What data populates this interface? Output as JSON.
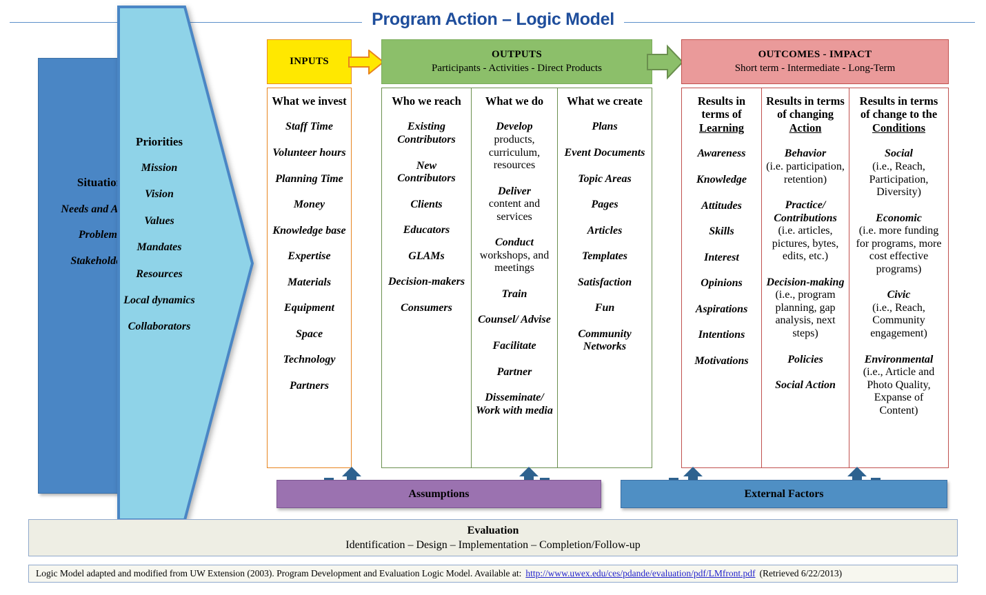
{
  "title": "Program Action – Logic Model",
  "situation": {
    "heading": "Situation",
    "items": [
      "Needs and Assets",
      "Problems",
      "Stakeholders"
    ]
  },
  "priorities": {
    "heading": "Priorities",
    "items": [
      "Mission",
      "Vision",
      "Values",
      "Mandates",
      "Resources",
      "Local dynamics",
      "Collaborators"
    ]
  },
  "banners": {
    "inputs": {
      "title": "INPUTS",
      "subtitle": ""
    },
    "outputs": {
      "title": "OUTPUTS",
      "subtitle": "Participants  -  Activities  -  Direct Products"
    },
    "outcomes": {
      "title": "OUTCOMES - IMPACT",
      "subtitle": "Short term  -  Intermediate  -  Long-Term"
    }
  },
  "columns": {
    "invest": {
      "heading": "What we invest",
      "items": [
        "Staff Time",
        "Volunteer hours",
        "Planning Time",
        "Money",
        "Knowledge base",
        "Expertise",
        "Materials",
        "Equipment",
        "Space",
        "Technology",
        "Partners"
      ]
    },
    "reach": {
      "heading": "Who we reach",
      "items": [
        "Existing Contributors",
        "New Contributors",
        "Clients",
        "Educators",
        "GLAMs",
        "Decision-makers",
        "Consumers"
      ]
    },
    "do": {
      "heading": "What we do",
      "items": [
        {
          "bold": "Develop",
          "plain": "products, curriculum, resources"
        },
        {
          "bold": "Deliver",
          "plain": "content and services"
        },
        {
          "bold": "Conduct",
          "plain": "workshops, and meetings"
        },
        {
          "bold": "Train",
          "plain": ""
        },
        {
          "bold": "Counsel/ Advise",
          "plain": ""
        },
        {
          "bold": "Facilitate",
          "plain": ""
        },
        {
          "bold": "Partner",
          "plain": ""
        },
        {
          "bold": "Disseminate/ Work with media",
          "plain": ""
        }
      ]
    },
    "create": {
      "heading": "What we create",
      "items": [
        "Plans",
        "Event Documents",
        "Topic Areas",
        "Pages",
        "Articles",
        "Templates",
        "Satisfaction",
        "Fun",
        "Community Networks"
      ]
    },
    "learning": {
      "heading_line1": "Results in terms of",
      "heading_underlined": "Learning",
      "items": [
        "Awareness",
        "Knowledge",
        "Attitudes",
        "Skills",
        "Interest",
        "Opinions",
        "Aspirations",
        "Intentions",
        "Motivations"
      ]
    },
    "action": {
      "heading_line1": "Results in terms of changing",
      "heading_underlined": "Action",
      "items": [
        {
          "bold": "Behavior",
          "plain": "(i.e. participation, retention)"
        },
        {
          "bold": "Practice/ Contributions",
          "plain": "(i.e. articles, pictures, bytes, edits, etc.)"
        },
        {
          "bold": "Decision-making",
          "plain": "(i.e., program planning, gap analysis, next steps)"
        },
        {
          "bold": "Policies",
          "plain": ""
        },
        {
          "bold": "Social Action",
          "plain": ""
        }
      ]
    },
    "conditions": {
      "heading_line1": "Results in terms of change to the",
      "heading_underlined": "Conditions",
      "items": [
        {
          "bold": "Social",
          "plain": "(i.e.,  Reach, Participation, Diversity)"
        },
        {
          "bold": "Economic",
          "plain": "(i.e. more funding for programs, more cost effective programs)"
        },
        {
          "bold": "Civic",
          "plain": "(i.e., Reach, Community engagement)"
        },
        {
          "bold": "Environmental",
          "plain": "(i.e., Article and Photo Quality, Expanse of Content)"
        }
      ]
    }
  },
  "bars": {
    "assumptions": "Assumptions",
    "external_factors": "External Factors"
  },
  "evaluation": {
    "heading": "Evaluation",
    "subtitle": "Identification – Design – Implementation – Completion/Follow-up"
  },
  "footer": {
    "text_before": "Logic Model adapted and modified from UW Extension (2003). Program Development and Evaluation Logic Model. Available at:",
    "link": "http://www.uwex.edu/ces/pdande/evaluation/pdf/LMfront.pdf",
    "text_after": "(Retrieved 6/22/2013)"
  },
  "colors": {
    "title": "#1f4e9c",
    "situation": "#4a86c5",
    "priorities_arrow": "#8fd3e8",
    "inputs": "#ffe800",
    "outputs": "#8cbf6a",
    "outcomes": "#ea9a9a",
    "assumptions": "#9b72b0",
    "external": "#4f8fc4",
    "evaluation": "#eeeee4",
    "link": "#2222cc"
  }
}
